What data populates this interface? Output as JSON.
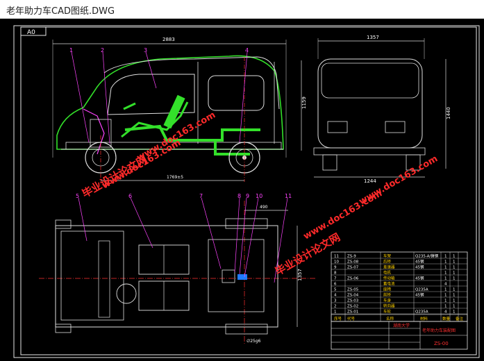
{
  "window": {
    "title": "老年助力车CAD图纸.DWG"
  },
  "drawing": {
    "sheet_size": "A0",
    "dims": {
      "side_length": "2883",
      "side_height": "1159",
      "wheelbase": "1769±5",
      "front_width": "1357",
      "front_height": "1440",
      "track": "1244",
      "plan_offset": "490",
      "plan_width": "1357",
      "shaft_dia": "∅25g6"
    },
    "callouts": [
      "1",
      "2",
      "3",
      "4",
      "5",
      "6",
      "7",
      "8",
      "9",
      "10",
      "11"
    ],
    "watermarks": {
      "text1": "毕业设计论文网",
      "text2": "www.doc163.com"
    },
    "bom": {
      "rows": [
        {
          "no": "11",
          "code": "ZS-9",
          "name": "车架",
          "mat": "Q235-A/铸钢",
          "qty": "1",
          "unit": "1"
        },
        {
          "no": "10",
          "code": "ZS-08",
          "name": "后桥",
          "mat": "45钢",
          "qty": "1",
          "unit": "1"
        },
        {
          "no": "9",
          "code": "ZS-07",
          "name": "差速器",
          "mat": "45钢",
          "qty": "1",
          "unit": "1"
        },
        {
          "no": "8",
          "code": "",
          "name": "电机",
          "mat": "",
          "qty": "1",
          "unit": "1"
        },
        {
          "no": "7",
          "code": "ZS-06",
          "name": "传动轴",
          "mat": "45钢",
          "qty": "1",
          "unit": "1"
        },
        {
          "no": "6",
          "code": "",
          "name": "蓄电池",
          "mat": "",
          "qty": "4",
          "unit": ""
        },
        {
          "no": "5",
          "code": "ZS-05",
          "name": "座椅",
          "mat": "Q235A",
          "qty": "1",
          "unit": "1"
        },
        {
          "no": "4",
          "code": "ZS-04",
          "name": "前桥",
          "mat": "45钢",
          "qty": "1",
          "unit": "1"
        },
        {
          "no": "3",
          "code": "ZS-03",
          "name": "车身",
          "mat": "",
          "qty": "1",
          "unit": "1"
        },
        {
          "no": "2",
          "code": "ZS-02",
          "name": "转向器",
          "mat": "",
          "qty": "1",
          "unit": "1"
        },
        {
          "no": "1",
          "code": "ZS-01",
          "name": "车轮",
          "mat": "Q235A",
          "qty": "4",
          "unit": "1"
        }
      ],
      "header": {
        "no": "序号",
        "code": "代号",
        "name": "名称",
        "mat": "材料",
        "qty": "数量",
        "note": "备注"
      }
    },
    "title_block": {
      "school": "湖南大学",
      "drawing_name": "老年助力车装配图",
      "drawing_no": "ZS-00"
    }
  }
}
